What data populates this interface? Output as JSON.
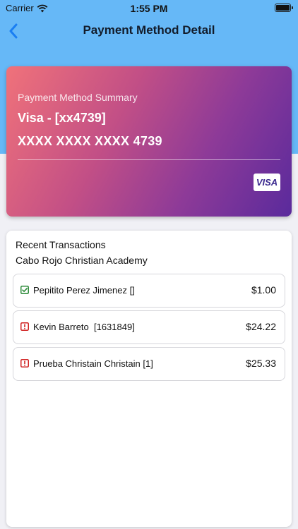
{
  "status_bar": {
    "carrier": "Carrier",
    "time": "1:55 PM"
  },
  "nav": {
    "title": "Payment Method Detail",
    "back_icon": "chevron-left-icon"
  },
  "payment_card": {
    "summary_label": "Payment Method Summary",
    "card_name": "Visa - [xx4739]",
    "card_number": "XXXX XXXX XXXX 4739",
    "brand": "VISA"
  },
  "transactions": {
    "header": "Recent Transactions",
    "school": "Cabo Rojo Christian Academy",
    "items": [
      {
        "name": "Pepitito Perez Jimenez []",
        "amount": "$1.00",
        "status": "success",
        "status_icon": "checkbox-checked-icon",
        "color": "#2e8b3a"
      },
      {
        "name": "Kevin Barreto  [1631849]",
        "amount": "$24.22",
        "status": "error",
        "status_icon": "alert-icon",
        "color": "#d02020"
      },
      {
        "name": "Prueba Christain Christain [1]",
        "amount": "$25.33",
        "status": "error",
        "status_icon": "alert-icon",
        "color": "#d02020"
      }
    ]
  },
  "colors": {
    "header_bg": "#66b8f7",
    "accent": "#1a7ef2"
  }
}
